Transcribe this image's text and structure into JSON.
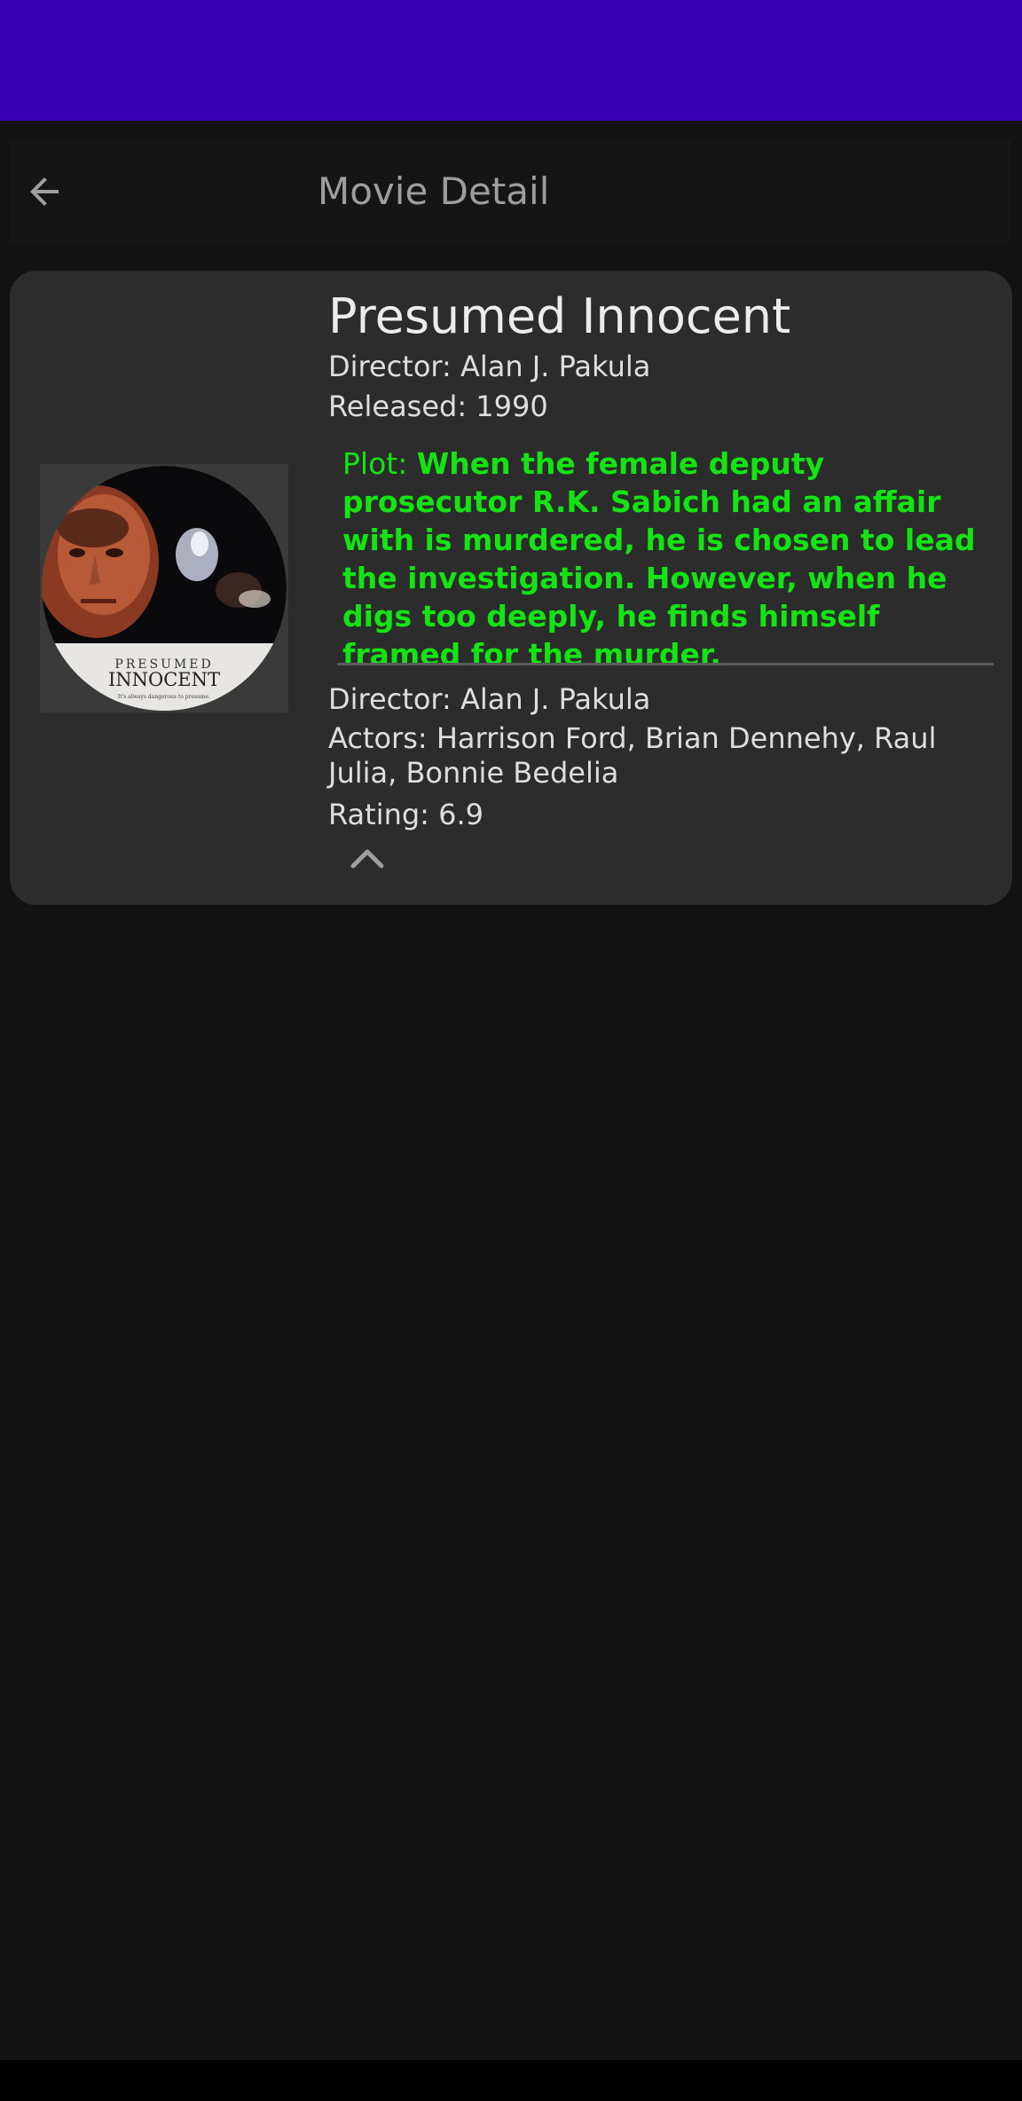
{
  "app_bar": {
    "title": "Movie Detail",
    "back_icon": "arrow-back-icon"
  },
  "movie": {
    "title": "Presumed Innocent",
    "director_line": "Director: Alan J. Pakula",
    "released_line": "Released: 1990",
    "plot_label": "Plot: ",
    "plot_text": "When the female deputy prosecutor R.K. Sabich had an affair with is murdered, he is chosen to lead the investigation. However, when he digs too deeply, he finds himself framed for the murder.",
    "director_detail_line": "Director: Alan J. Pakula",
    "actors_line": "Actors: Harrison Ford, Brian Dennehy, Raul Julia, Bonnie Bedelia",
    "rating_line": "Rating: 6.9",
    "poster_caption_top": "PRESUMED",
    "poster_caption_main": "INNOCENT",
    "poster_tagline": "It's always dangerous to presume.",
    "collapse_icon": "chevron-up-icon"
  },
  "colors": {
    "status_bar": "#3700b3",
    "background": "#121212",
    "card": "#2c2c2c",
    "plot_green": "#14e314"
  }
}
